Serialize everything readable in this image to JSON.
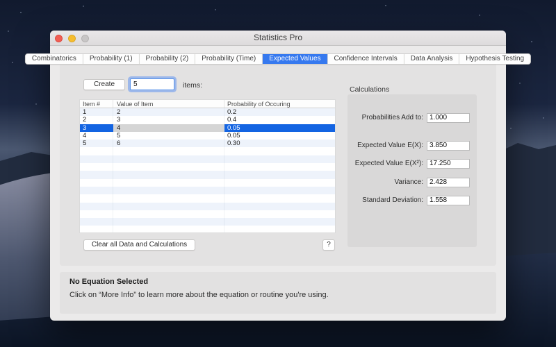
{
  "window": {
    "title": "Statistics Pro"
  },
  "tabs": {
    "items": [
      "Combinatorics",
      "Probability (1)",
      "Probability (2)",
      "Probability (Time)",
      "Expected Values",
      "Confidence Intervals",
      "Data Analysis",
      "Hypothesis Testing"
    ],
    "selected": "Expected Values"
  },
  "toolbar": {
    "create_label": "Create",
    "count_value": "5",
    "items_label": "items:"
  },
  "table": {
    "columns": [
      "Item #",
      "Value of Item",
      "Probability of Occuring"
    ],
    "rows": [
      [
        "1",
        "2",
        "0.2"
      ],
      [
        "2",
        "3",
        "0.4"
      ],
      [
        "3",
        "4",
        "0.05"
      ],
      [
        "4",
        "5",
        "0.05"
      ],
      [
        "5",
        "6",
        "0.30"
      ]
    ],
    "selected_row_index": 2,
    "empty_row_count": 12
  },
  "actions": {
    "clear_label": "Clear all Data and Calculations",
    "help_label": "?"
  },
  "calculations": {
    "title": "Calculations",
    "fields": [
      {
        "label": "Probabilities Add to:",
        "value": "1.000"
      },
      {
        "label": "Expected Value  E(X):",
        "value": "3.850"
      },
      {
        "label": "Expected Value  E(X²):",
        "value": "17.250"
      },
      {
        "label": "Variance:",
        "value": "2.428"
      },
      {
        "label": "Standard Deviation:",
        "value": "1.558"
      }
    ]
  },
  "info_panel": {
    "title": "No Equation Selected",
    "body": "Click on “More Info” to learn more about the equation or routine you're using."
  },
  "colors": {
    "tab_accent": "#3679ef",
    "row_selection": "#1364e2",
    "row_stripe": "#eef3fb"
  }
}
